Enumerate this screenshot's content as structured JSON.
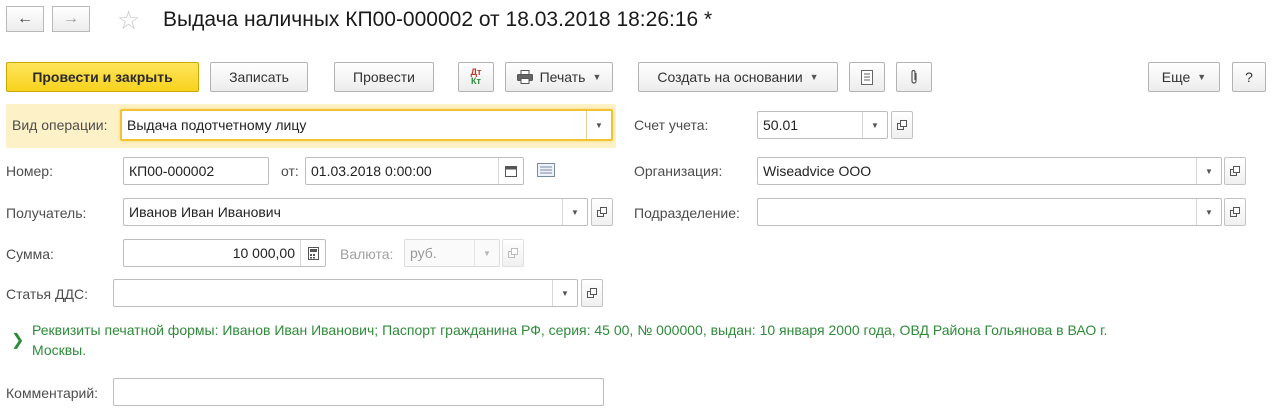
{
  "header": {
    "title": "Выдача наличных КП00-000002 от 18.03.2018 18:26:16 *",
    "back_icon": "arrow-left-icon",
    "forward_icon": "arrow-right-icon",
    "favorite_icon": "star-icon"
  },
  "toolbar": {
    "post_close": "Провести и закрыть",
    "save": "Записать",
    "post": "Провести",
    "dt_kt_top": "Дт",
    "dt_kt_bottom": "Кт",
    "print": "Печать",
    "create_based": "Создать на основании",
    "more": "Еще",
    "help": "?"
  },
  "form": {
    "operation_label": "Вид операции:",
    "operation_value": "Выдача подотчетному лицу",
    "account_label": "Счет учета:",
    "account_value": "50.01",
    "number_label": "Номер:",
    "number_value": "КП00-000002",
    "date_label": "от:",
    "date_value": "01.03.2018  0:00:00",
    "org_label": "Организация:",
    "org_value": "Wiseadvice ООО",
    "recipient_label": "Получатель:",
    "recipient_value": "Иванов Иван Иванович",
    "division_label": "Подразделение:",
    "division_value": "",
    "sum_label": "Сумма:",
    "sum_value": "10 000,00",
    "currency_label": "Валюта:",
    "currency_value": "руб.",
    "dds_label": "Статья ДДС:",
    "dds_value": "",
    "print_requisites": "Реквизиты печатной формы: Иванов Иван Иванович; Паспорт гражданина РФ, серия: 45 00, № 000000, выдан: 10 января 2000 года, ОВД Района Гольянова в ВАО г. Москвы.",
    "comment_label": "Комментарий:",
    "comment_value": ""
  },
  "colors": {
    "primary_button": "#f7d21d",
    "highlight_row": "#fdf1c8",
    "info_text": "#2e8b3a"
  }
}
